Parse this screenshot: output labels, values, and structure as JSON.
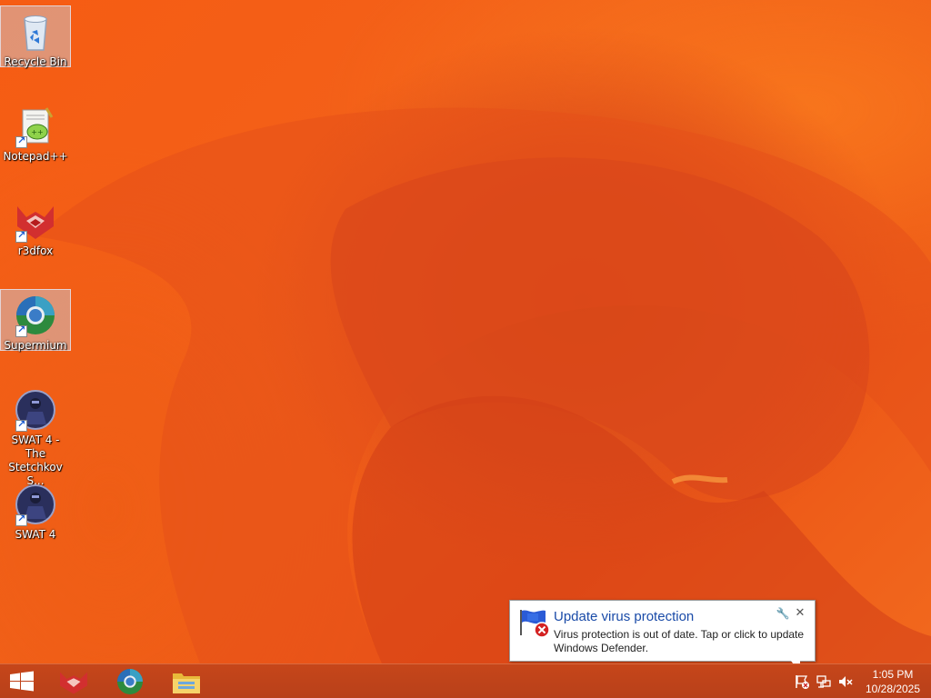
{
  "desktop": {
    "icons": [
      {
        "label": "Recycle Bin",
        "icon": "recycle-bin-icon"
      },
      {
        "label": "Notepad++",
        "icon": "notepadpp-icon"
      },
      {
        "label": "r3dfox",
        "icon": "r3dfox-icon"
      },
      {
        "label": "Supermium",
        "icon": "supermium-icon"
      },
      {
        "label": "SWAT 4 - The Stetchkov S...",
        "icon": "swat4-icon"
      },
      {
        "label": "SWAT 4",
        "icon": "swat4-icon"
      }
    ]
  },
  "notification": {
    "title": "Update virus protection",
    "message": "Virus protection is out of date. Tap or click to update Windows Defender.",
    "icon": "windows-defender-warning-icon"
  },
  "taskbar": {
    "start_icon": "windows-logo-icon",
    "pinned_apps": [
      "r3dfox-icon",
      "supermium-icon",
      "file-explorer-icon"
    ],
    "tray_icons": [
      "action-center-flag-icon",
      "network-icon",
      "volume-muted-icon"
    ],
    "clock": {
      "time": "1:05 PM",
      "date": "10/28/2025"
    }
  },
  "colors": {
    "wallpaper": "#f25c14",
    "taskbar": "#be441a",
    "notification_title": "#1a4ba8"
  }
}
